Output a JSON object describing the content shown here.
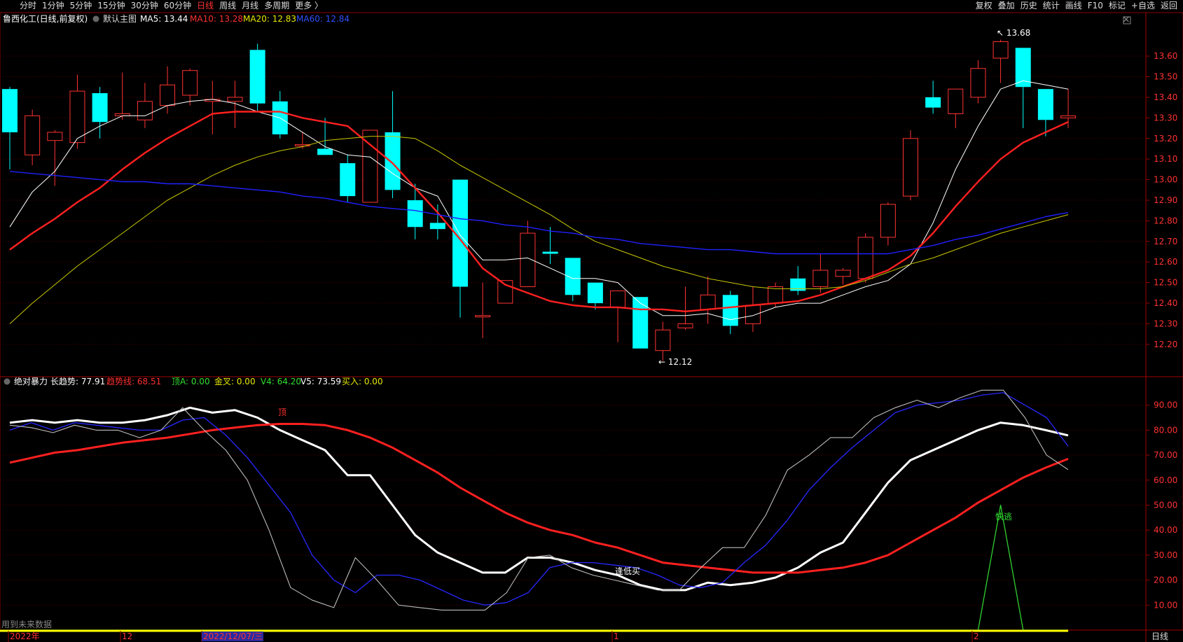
{
  "toolbar": {
    "left": [
      "分时",
      "1分钟",
      "5分钟",
      "15分钟",
      "30分钟",
      "60分钟",
      "日线",
      "周线",
      "月线",
      "多周期",
      "更多 〉"
    ],
    "active": "日线",
    "right": [
      "复权",
      "叠加",
      "历史",
      "统计",
      "画线",
      "F10",
      "标记",
      "+自选",
      "返回"
    ]
  },
  "main_legend": {
    "name": "鲁西化工(日线,前复权)",
    "template": "默认主图",
    "ma5": "MA5: 13.44",
    "ma10": "MA10: 13.28",
    "ma20": "MA20: 12.83",
    "ma60": "MA60: 12.84"
  },
  "ind_legend": {
    "name": "绝对暴力",
    "long": "长趋势: 77.91",
    "trend": "趋势线: 68.51",
    "topA": "顶A: 0.00",
    "gold": "金叉: 0.00",
    "v4": "V4: 64.20",
    "v5": "V5: 73.59",
    "buy": "买入: 0.00"
  },
  "annotations": {
    "high": "13.68",
    "low": "12.12",
    "top": "顶",
    "low_buy": "逢低买",
    "escape": "快逃",
    "future": "用到未来数据"
  },
  "date_axis": {
    "labels": [
      "2022年",
      "12",
      "2022/12/07/三",
      "1",
      "2"
    ],
    "period": "日线"
  },
  "colors": {
    "up": "#ff3232",
    "down": "#00ffff",
    "ma5": "#ffffff",
    "ma10": "#ff2020",
    "ma20": "#c8c800",
    "ma60": "#2020ff"
  },
  "chart_data": [
    {
      "type": "candlestick",
      "title": "鲁西化工(日线,前复权)",
      "ylim": [
        12.05,
        13.75
      ],
      "yticks": [
        12.2,
        12.3,
        12.4,
        12.5,
        12.6,
        12.7,
        12.8,
        12.9,
        13.0,
        13.1,
        13.2,
        13.3,
        13.4,
        13.5,
        13.6
      ],
      "ohlc": [
        [
          13.44,
          13.45,
          13.05,
          13.23
        ],
        [
          13.12,
          13.34,
          13.07,
          13.31
        ],
        [
          13.19,
          13.24,
          12.97,
          13.23
        ],
        [
          13.18,
          13.51,
          13.15,
          13.43
        ],
        [
          13.42,
          13.45,
          13.2,
          13.28
        ],
        [
          13.31,
          13.52,
          13.29,
          13.32
        ],
        [
          13.29,
          13.47,
          13.25,
          13.38
        ],
        [
          13.36,
          13.55,
          13.32,
          13.46
        ],
        [
          13.41,
          13.54,
          13.36,
          13.53
        ],
        [
          13.38,
          13.48,
          13.22,
          13.39
        ],
        [
          13.38,
          13.48,
          13.25,
          13.4
        ],
        [
          13.63,
          13.66,
          13.33,
          13.37
        ],
        [
          13.38,
          13.43,
          13.2,
          13.22
        ],
        [
          13.17,
          13.23,
          13.15,
          13.17
        ],
        [
          13.15,
          13.3,
          13.12,
          13.12
        ],
        [
          13.08,
          13.12,
          12.89,
          12.92
        ],
        [
          12.89,
          13.24,
          12.89,
          13.24
        ],
        [
          13.23,
          13.43,
          12.91,
          12.95
        ],
        [
          12.9,
          12.98,
          12.71,
          12.77
        ],
        [
          12.79,
          12.88,
          12.71,
          12.76
        ],
        [
          13.0,
          13.0,
          12.33,
          12.48
        ],
        [
          12.34,
          12.5,
          12.23,
          12.34
        ],
        [
          12.4,
          12.51,
          12.4,
          12.51
        ],
        [
          12.48,
          12.8,
          12.48,
          12.74
        ],
        [
          12.65,
          12.77,
          12.59,
          12.64
        ],
        [
          12.62,
          12.62,
          12.41,
          12.44
        ],
        [
          12.5,
          12.5,
          12.37,
          12.4
        ],
        [
          12.38,
          12.46,
          12.21,
          12.46
        ],
        [
          12.43,
          12.43,
          12.18,
          12.18
        ],
        [
          12.17,
          12.31,
          12.12,
          12.27
        ],
        [
          12.28,
          12.48,
          12.27,
          12.3
        ],
        [
          12.37,
          12.53,
          12.3,
          12.44
        ],
        [
          12.44,
          12.46,
          12.25,
          12.29
        ],
        [
          12.3,
          12.48,
          12.26,
          12.39
        ],
        [
          12.4,
          12.5,
          12.38,
          12.48
        ],
        [
          12.52,
          12.58,
          12.44,
          12.46
        ],
        [
          12.48,
          12.64,
          12.45,
          12.56
        ],
        [
          12.53,
          12.57,
          12.49,
          12.56
        ],
        [
          12.52,
          12.74,
          12.5,
          12.72
        ],
        [
          12.72,
          12.89,
          12.68,
          12.88
        ],
        [
          12.92,
          13.24,
          12.9,
          13.2
        ],
        [
          13.4,
          13.48,
          13.32,
          13.35
        ],
        [
          13.32,
          13.43,
          13.25,
          13.44
        ],
        [
          13.4,
          13.58,
          13.37,
          13.54
        ],
        [
          13.59,
          13.68,
          13.47,
          13.67
        ],
        [
          13.64,
          13.64,
          13.25,
          13.45
        ],
        [
          13.44,
          13.44,
          13.21,
          13.29
        ],
        [
          13.3,
          13.44,
          13.25,
          13.31
        ]
      ],
      "series": [
        {
          "name": "MA5",
          "values": [
            12.77,
            12.94,
            13.04,
            13.2,
            13.26,
            13.31,
            13.31,
            13.36,
            13.38,
            13.39,
            13.37,
            13.33,
            13.3,
            13.23,
            13.16,
            13.12,
            13.11,
            13.03,
            12.96,
            12.92,
            12.73,
            12.61,
            12.61,
            12.62,
            12.57,
            12.52,
            12.52,
            12.5,
            12.4,
            12.34,
            12.34,
            12.35,
            12.32,
            12.34,
            12.38,
            12.4,
            12.4,
            12.44,
            12.48,
            12.51,
            12.59,
            12.79,
            13.05,
            13.26,
            13.44,
            13.48,
            13.46,
            13.44
          ]
        },
        {
          "name": "MA10",
          "values": [
            12.66,
            12.74,
            12.81,
            12.89,
            12.96,
            13.05,
            13.13,
            13.2,
            13.26,
            13.32,
            13.33,
            13.33,
            13.33,
            13.3,
            13.28,
            13.26,
            13.17,
            13.08,
            12.96,
            12.84,
            12.71,
            12.57,
            12.49,
            12.45,
            12.41,
            12.39,
            12.38,
            12.38,
            12.37,
            12.37,
            12.36,
            12.37,
            12.38,
            12.39,
            12.4,
            12.41,
            12.44,
            12.48,
            12.52,
            12.56,
            12.63,
            12.74,
            12.87,
            12.99,
            13.1,
            13.18,
            13.23,
            13.28
          ]
        },
        {
          "name": "MA20",
          "values": [
            12.3,
            12.4,
            12.49,
            12.58,
            12.66,
            12.74,
            12.82,
            12.9,
            12.96,
            13.02,
            13.07,
            13.11,
            13.14,
            13.16,
            13.19,
            13.2,
            13.21,
            13.21,
            13.2,
            13.14,
            13.07,
            13.01,
            12.95,
            12.89,
            12.83,
            12.76,
            12.7,
            12.66,
            12.62,
            12.58,
            12.55,
            12.52,
            12.5,
            12.48,
            12.47,
            12.47,
            12.47,
            12.48,
            12.51,
            12.55,
            12.59,
            12.62,
            12.66,
            12.7,
            12.74,
            12.77,
            12.8,
            12.83
          ]
        },
        {
          "name": "MA60",
          "values": [
            13.04,
            13.03,
            13.02,
            13.01,
            13.0,
            12.99,
            12.99,
            12.98,
            12.98,
            12.97,
            12.96,
            12.95,
            12.94,
            12.92,
            12.91,
            12.89,
            12.87,
            12.86,
            12.85,
            12.83,
            12.81,
            12.8,
            12.78,
            12.77,
            12.75,
            12.74,
            12.72,
            12.71,
            12.69,
            12.68,
            12.67,
            12.66,
            12.66,
            12.65,
            12.64,
            12.64,
            12.64,
            12.64,
            12.64,
            12.64,
            12.66,
            12.68,
            12.71,
            12.73,
            12.76,
            12.79,
            12.82,
            12.84
          ]
        }
      ]
    },
    {
      "type": "line",
      "title": "绝对暴力",
      "ylim": [
        0,
        100
      ],
      "yticks": [
        10,
        20,
        30,
        40,
        50,
        60,
        70,
        80,
        90
      ],
      "series": [
        {
          "name": "长趋势",
          "values": [
            83,
            84,
            83,
            84,
            83,
            83,
            84,
            86,
            89,
            87,
            88,
            85,
            80,
            76,
            72,
            62,
            62,
            50,
            38,
            31,
            27,
            23,
            23,
            29,
            29,
            27,
            24,
            22,
            18,
            16,
            16,
            19,
            18,
            19,
            21,
            25,
            31,
            35,
            47,
            59,
            68,
            72,
            76,
            80,
            83,
            82,
            80,
            77.91
          ]
        },
        {
          "name": "趋势线",
          "values": [
            67,
            69,
            71,
            72,
            73.5,
            75,
            76,
            77,
            78.5,
            80,
            81,
            82,
            82.5,
            82.5,
            82,
            80,
            77,
            73,
            68,
            63,
            57,
            52,
            47,
            43,
            40,
            38,
            35,
            33,
            30,
            27,
            26,
            25,
            24,
            23,
            23,
            23,
            24,
            25,
            27,
            30,
            35,
            40,
            45,
            51,
            56,
            61,
            65,
            68.51
          ]
        },
        {
          "name": "V4",
          "values": [
            80,
            83,
            80,
            83,
            82,
            81,
            80,
            80,
            84,
            85,
            78,
            69,
            58,
            47,
            30,
            20,
            15,
            22,
            22,
            20,
            16,
            12,
            10,
            11,
            15,
            25,
            27,
            27,
            26,
            25,
            22,
            18,
            17,
            19,
            27,
            34,
            44,
            56,
            65,
            73,
            80,
            87,
            90,
            91,
            92,
            94,
            95,
            90,
            85,
            73.59
          ]
        },
        {
          "name": "V5",
          "values": [
            82,
            81,
            79,
            82,
            80,
            80,
            77,
            80,
            89,
            80,
            72,
            60,
            40,
            17,
            12,
            9,
            29,
            20,
            10,
            9,
            8,
            8,
            8,
            15,
            29,
            30,
            25,
            22,
            20,
            18,
            16,
            16,
            25,
            33,
            33,
            46,
            64,
            70,
            77,
            77,
            85,
            89,
            92,
            89,
            93,
            96,
            96,
            85,
            70,
            64.2
          ]
        },
        {
          "name": "快逃",
          "values": [
            0,
            0,
            0,
            0,
            0,
            0,
            0,
            0,
            0,
            0,
            0,
            0,
            0,
            0,
            0,
            0,
            0,
            0,
            0,
            0,
            0,
            0,
            0,
            0,
            0,
            0,
            0,
            0,
            0,
            0,
            0,
            0,
            0,
            0,
            0,
            0,
            0,
            0,
            0,
            0,
            0,
            0,
            0,
            0,
            50,
            0,
            0,
            0
          ]
        }
      ]
    }
  ]
}
